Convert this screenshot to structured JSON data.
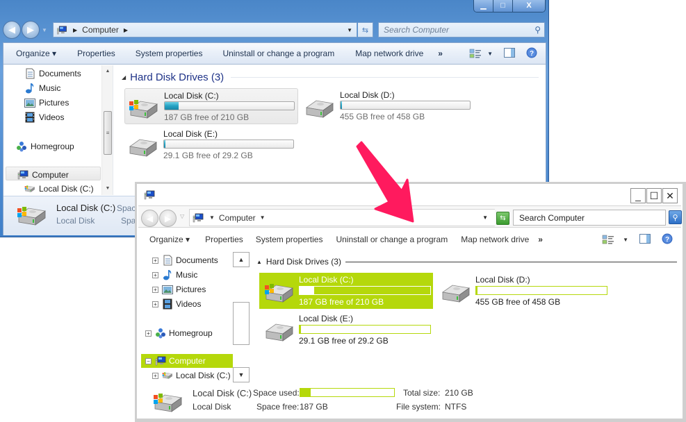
{
  "win7": {
    "window_buttons": {
      "minimize": "▁",
      "maximize": "□",
      "close": "X"
    },
    "address": {
      "crumbs": [
        "Computer"
      ]
    },
    "search": {
      "placeholder": "Search Computer"
    },
    "toolbar": {
      "organize": "Organize ▾",
      "properties": "Properties",
      "system_properties": "System properties",
      "uninstall": "Uninstall or change a program",
      "map_drive": "Map network drive",
      "more": "»"
    },
    "nav": {
      "items": [
        {
          "label": "Documents",
          "icon": "documents-icon"
        },
        {
          "label": "Music",
          "icon": "music-icon"
        },
        {
          "label": "Pictures",
          "icon": "pictures-icon"
        },
        {
          "label": "Videos",
          "icon": "videos-icon"
        },
        {
          "label": "Homegroup",
          "icon": "homegroup-icon"
        },
        {
          "label": "Computer",
          "icon": "computer-icon",
          "selected": true
        },
        {
          "label": "Local Disk (C:)",
          "icon": "windows-drive-icon"
        }
      ]
    },
    "group": {
      "title": "Hard Disk Drives (3)"
    },
    "drives": [
      {
        "name": "Local Disk (C:)",
        "info": "187 GB free of 210 GB",
        "used_fraction": 0.11,
        "selected": true
      },
      {
        "name": "Local Disk (D:)",
        "info": "455 GB free of 458 GB",
        "used_fraction": 0.007
      },
      {
        "name": "Local Disk (E:)",
        "info": "29.1 GB free of 29.2 GB",
        "used_fraction": 0.003
      }
    ],
    "details": {
      "name": "Local Disk (C:)",
      "type": "Local Disk",
      "space_used_label": "Space used:",
      "space_free_label": "Space free:"
    }
  },
  "win8": {
    "window_buttons": {
      "minimize": "_",
      "maximize": "☐",
      "close": "✕"
    },
    "address": {
      "crumbs": [
        "Computer"
      ]
    },
    "search": {
      "value": "Search Computer"
    },
    "toolbar": {
      "organize": "Organize ▾",
      "properties": "Properties",
      "system_properties": "System properties",
      "uninstall": "Uninstall or change a program",
      "map_drive": "Map network drive",
      "more": "»"
    },
    "nav": {
      "items": [
        {
          "label": "Documents"
        },
        {
          "label": "Music"
        },
        {
          "label": "Pictures"
        },
        {
          "label": "Videos"
        },
        {
          "label": "Homegroup"
        },
        {
          "label": "Computer",
          "selected": true
        },
        {
          "label": "Local Disk (C:)"
        }
      ]
    },
    "group": {
      "title": "Hard Disk Drives (3)"
    },
    "drives": [
      {
        "name": "Local Disk (C:)",
        "info": "187 GB free of 210 GB",
        "used_fraction": 0.11,
        "selected": true
      },
      {
        "name": "Local Disk (D:)",
        "info": "455 GB free of 458 GB",
        "used_fraction": 0.007
      },
      {
        "name": "Local Disk (E:)",
        "info": "29.1 GB free of 29.2 GB",
        "used_fraction": 0.003
      }
    ],
    "details": {
      "name": "Local Disk (C:)",
      "type": "Local Disk",
      "space_used_label": "Space used:",
      "space_used_fraction": 0.11,
      "space_free_label": "Space free:",
      "space_free_value": "187 GB",
      "total_size_label": "Total size:",
      "total_size_value": "210 GB",
      "file_system_label": "File system:",
      "file_system_value": "NTFS"
    }
  },
  "colors": {
    "accent_green": "#b5d80b",
    "arrow": "#ff1a5e",
    "win7_progress": "#26a3c4"
  }
}
